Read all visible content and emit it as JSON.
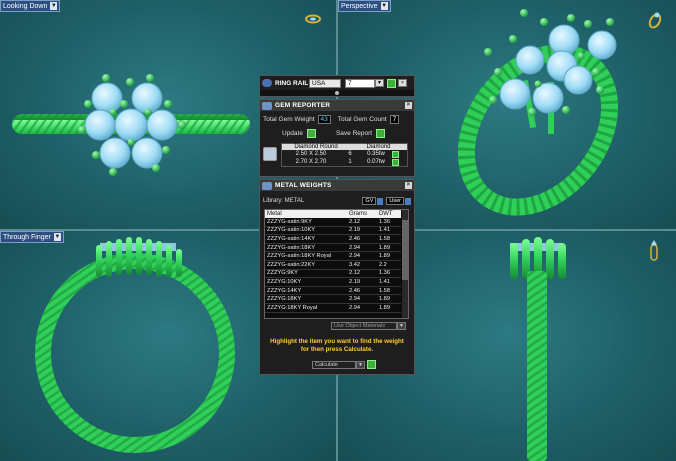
{
  "viewports": {
    "top_left": {
      "label": "Looking Down"
    },
    "top_right": {
      "label": "Perspective"
    },
    "bottom_left": {
      "label": "Through Finger"
    },
    "bottom_right": {
      "label": ""
    }
  },
  "ring_rail": {
    "title": "RING RAIL",
    "region": "USA",
    "size": "7"
  },
  "gem_reporter": {
    "title": "GEM REPORTER",
    "total_weight_label": "Total Gem Weight",
    "total_weight_value": "43",
    "total_count_label": "Total Gem Count",
    "total_count_value": "7",
    "update_label": "Update",
    "save_report_label": "Save Report",
    "gem_name": "Diamond Round",
    "gem_type": "Diamond",
    "rows": [
      {
        "size": "2.50 X 2.50",
        "count": "6",
        "weight": "0.35tw"
      },
      {
        "size": "2.70 X 2.70",
        "count": "1",
        "weight": "0.07tw"
      }
    ]
  },
  "metal_weights": {
    "title": "METAL WEIGHTS",
    "library_label": "Library: METAL",
    "gv_label": "GV",
    "user_label": "User",
    "columns": [
      "Metal",
      "Grams",
      "DWT"
    ],
    "rows": [
      [
        "ZZZYG-satin:9KY",
        "2.12",
        "1.36"
      ],
      [
        "ZZZYG-satin:10KY",
        "2.19",
        "1.41"
      ],
      [
        "ZZZYG-satin:14KY",
        "2.46",
        "1.58"
      ],
      [
        "ZZZYG-satin:18KY",
        "2.94",
        "1.89"
      ],
      [
        "ZZZYG-satin:18KY Royal",
        "2.94",
        "1.89"
      ],
      [
        "ZZZYG-satin:22KY",
        "3.42",
        "2.2"
      ],
      [
        "ZZZYG:9KY",
        "2.12",
        "1.36"
      ],
      [
        "ZZZYG:10KY",
        "2.19",
        "1.41"
      ],
      [
        "ZZZYG:14KY",
        "2.46",
        "1.58"
      ],
      [
        "ZZZYG:18KY",
        "2.94",
        "1.89"
      ],
      [
        "ZZZYG:18KY Royal",
        "2.94",
        "1.89"
      ]
    ],
    "use_object_materials": "Use Object Materials",
    "instruction": "Highlight the item you want to find the weight for then press Calculate.",
    "calculate_label": "Calculate"
  },
  "colors": {
    "metal_green": "#3ee86a",
    "gem_blue": "#9fdcf5",
    "viewport_bg": "#1f6068",
    "instruction_yellow": "#ffcc33"
  }
}
